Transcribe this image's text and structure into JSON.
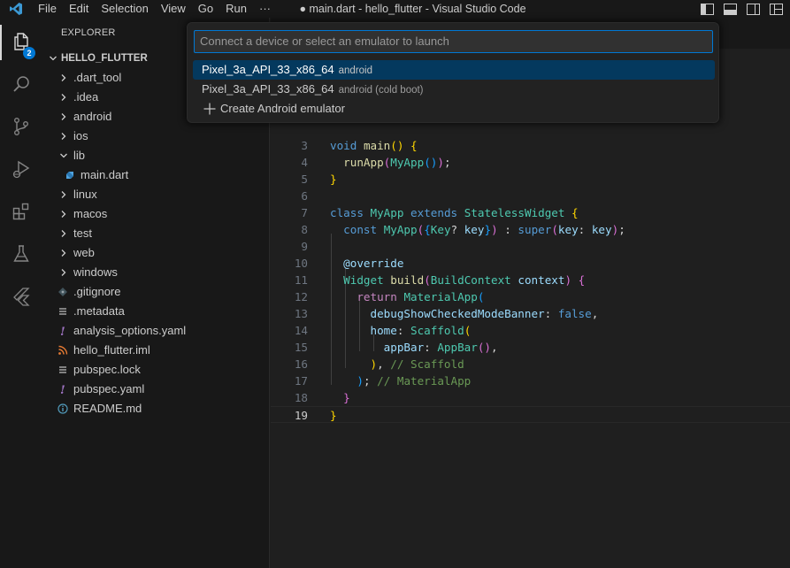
{
  "titlebar": {
    "menu": [
      "File",
      "Edit",
      "Selection",
      "View",
      "Go",
      "Run",
      "···"
    ],
    "window_title": "● main.dart - hello_flutter - Visual Studio Code"
  },
  "activitybar": {
    "items": [
      {
        "name": "explorer",
        "icon": "files-icon",
        "badge": "2"
      },
      {
        "name": "search",
        "icon": "search-icon"
      },
      {
        "name": "source-control",
        "icon": "source-control-icon"
      },
      {
        "name": "run-debug",
        "icon": "run-debug-icon"
      },
      {
        "name": "extensions",
        "icon": "extensions-icon"
      },
      {
        "name": "testing",
        "icon": "beaker-icon"
      },
      {
        "name": "flutter",
        "icon": "flutter-icon"
      }
    ]
  },
  "sidebar": {
    "header": "EXPLORER",
    "root": "HELLO_FLUTTER",
    "items": [
      {
        "label": ".dart_tool",
        "type": "folder",
        "expanded": false
      },
      {
        "label": ".idea",
        "type": "folder",
        "expanded": false
      },
      {
        "label": "android",
        "type": "folder",
        "expanded": false
      },
      {
        "label": "ios",
        "type": "folder",
        "expanded": false
      },
      {
        "label": "lib",
        "type": "folder",
        "expanded": true
      },
      {
        "label": "main.dart",
        "type": "dart-file"
      },
      {
        "label": "linux",
        "type": "folder",
        "expanded": false
      },
      {
        "label": "macos",
        "type": "folder",
        "expanded": false
      },
      {
        "label": "test",
        "type": "folder",
        "expanded": false
      },
      {
        "label": "web",
        "type": "folder",
        "expanded": false
      },
      {
        "label": "windows",
        "type": "folder",
        "expanded": false
      },
      {
        "label": ".gitignore",
        "type": "gitignore-file"
      },
      {
        "label": ".metadata",
        "type": "text-file"
      },
      {
        "label": "analysis_options.yaml",
        "type": "yaml-file"
      },
      {
        "label": "hello_flutter.iml",
        "type": "rss-file"
      },
      {
        "label": "pubspec.lock",
        "type": "text-file"
      },
      {
        "label": "pubspec.yaml",
        "type": "yaml-file"
      },
      {
        "label": "README.md",
        "type": "info-file"
      }
    ]
  },
  "editor": {
    "lines": [
      {
        "n": "3",
        "tokens": [
          [
            "kw",
            "void"
          ],
          [
            "pl",
            " "
          ],
          [
            "fn",
            "main"
          ],
          [
            "p1",
            "()"
          ],
          [
            "pl",
            " "
          ],
          [
            "p1",
            "{"
          ]
        ]
      },
      {
        "n": "4",
        "tokens": [
          [
            "pl",
            "  "
          ],
          [
            "fn",
            "runApp"
          ],
          [
            "p2",
            "("
          ],
          [
            "ty",
            "MyApp"
          ],
          [
            "p3",
            "()"
          ],
          [
            "p2",
            ")"
          ],
          [
            "pl",
            ";"
          ]
        ]
      },
      {
        "n": "5",
        "tokens": [
          [
            "p1",
            "}"
          ]
        ]
      },
      {
        "n": "6",
        "tokens": []
      },
      {
        "n": "7",
        "tokens": [
          [
            "kw",
            "class"
          ],
          [
            "pl",
            " "
          ],
          [
            "ty",
            "MyApp"
          ],
          [
            "pl",
            " "
          ],
          [
            "kw",
            "extends"
          ],
          [
            "pl",
            " "
          ],
          [
            "ty",
            "StatelessWidget"
          ],
          [
            "pl",
            " "
          ],
          [
            "p1",
            "{"
          ]
        ]
      },
      {
        "n": "8",
        "tokens": [
          [
            "pl",
            "  "
          ],
          [
            "kw",
            "const"
          ],
          [
            "pl",
            " "
          ],
          [
            "ty",
            "MyApp"
          ],
          [
            "p2",
            "("
          ],
          [
            "p3",
            "{"
          ],
          [
            "ty",
            "Key"
          ],
          [
            "pl",
            "? "
          ],
          [
            "var",
            "key"
          ],
          [
            "p3",
            "}"
          ],
          [
            "p2",
            ")"
          ],
          [
            "pl",
            " : "
          ],
          [
            "kw",
            "super"
          ],
          [
            "p2",
            "("
          ],
          [
            "var",
            "key"
          ],
          [
            "pl",
            ": "
          ],
          [
            "var",
            "key"
          ],
          [
            "p2",
            ")"
          ],
          [
            "pl",
            ";"
          ]
        ]
      },
      {
        "n": "9",
        "tokens": []
      },
      {
        "n": "10",
        "tokens": [
          [
            "pl",
            "  "
          ],
          [
            "var",
            "@override"
          ]
        ]
      },
      {
        "n": "11",
        "tokens": [
          [
            "pl",
            "  "
          ],
          [
            "ty",
            "Widget"
          ],
          [
            "pl",
            " "
          ],
          [
            "fn",
            "build"
          ],
          [
            "p2",
            "("
          ],
          [
            "ty",
            "BuildContext"
          ],
          [
            "pl",
            " "
          ],
          [
            "var",
            "context"
          ],
          [
            "p2",
            ")"
          ],
          [
            "pl",
            " "
          ],
          [
            "p2",
            "{"
          ]
        ]
      },
      {
        "n": "12",
        "tokens": [
          [
            "pl",
            "    "
          ],
          [
            "ctl",
            "return"
          ],
          [
            "pl",
            " "
          ],
          [
            "ty",
            "MaterialApp"
          ],
          [
            "p3",
            "("
          ]
        ]
      },
      {
        "n": "13",
        "tokens": [
          [
            "pl",
            "      "
          ],
          [
            "var",
            "debugShowCheckedModeBanner"
          ],
          [
            "pl",
            ": "
          ],
          [
            "kw",
            "false"
          ],
          [
            "pl",
            ","
          ]
        ]
      },
      {
        "n": "14",
        "tokens": [
          [
            "pl",
            "      "
          ],
          [
            "var",
            "home"
          ],
          [
            "pl",
            ": "
          ],
          [
            "ty",
            "Scaffold"
          ],
          [
            "p1",
            "("
          ]
        ]
      },
      {
        "n": "15",
        "tokens": [
          [
            "pl",
            "        "
          ],
          [
            "var",
            "appBar"
          ],
          [
            "pl",
            ": "
          ],
          [
            "ty",
            "AppBar"
          ],
          [
            "p2",
            "()"
          ],
          [
            "pl",
            ","
          ]
        ]
      },
      {
        "n": "16",
        "tokens": [
          [
            "pl",
            "      "
          ],
          [
            "p1",
            ")"
          ],
          [
            "pl",
            ", "
          ],
          [
            "cm",
            "// Scaffold"
          ]
        ]
      },
      {
        "n": "17",
        "tokens": [
          [
            "pl",
            "    "
          ],
          [
            "p3",
            ")"
          ],
          [
            "pl",
            "; "
          ],
          [
            "cm",
            "// MaterialApp"
          ]
        ]
      },
      {
        "n": "18",
        "tokens": [
          [
            "pl",
            "  "
          ],
          [
            "p2",
            "}"
          ]
        ]
      },
      {
        "n": "19",
        "tokens": [
          [
            "p1",
            "}"
          ]
        ],
        "current": true
      }
    ]
  },
  "quickpick": {
    "placeholder": "Connect a device or select an emulator to launch",
    "items": [
      {
        "label": "Pixel_3a_API_33_x86_64",
        "description": "android",
        "selected": true
      },
      {
        "label": "Pixel_3a_API_33_x86_64",
        "description": "android (cold boot)",
        "selected": false
      },
      {
        "label": "Create Android emulator",
        "description": "",
        "icon": "plus-icon",
        "selected": false
      }
    ]
  },
  "colors": {
    "accent": "#0078d4",
    "selection": "#04395e",
    "background": "#1f1f1f",
    "sidebar": "#181818"
  }
}
